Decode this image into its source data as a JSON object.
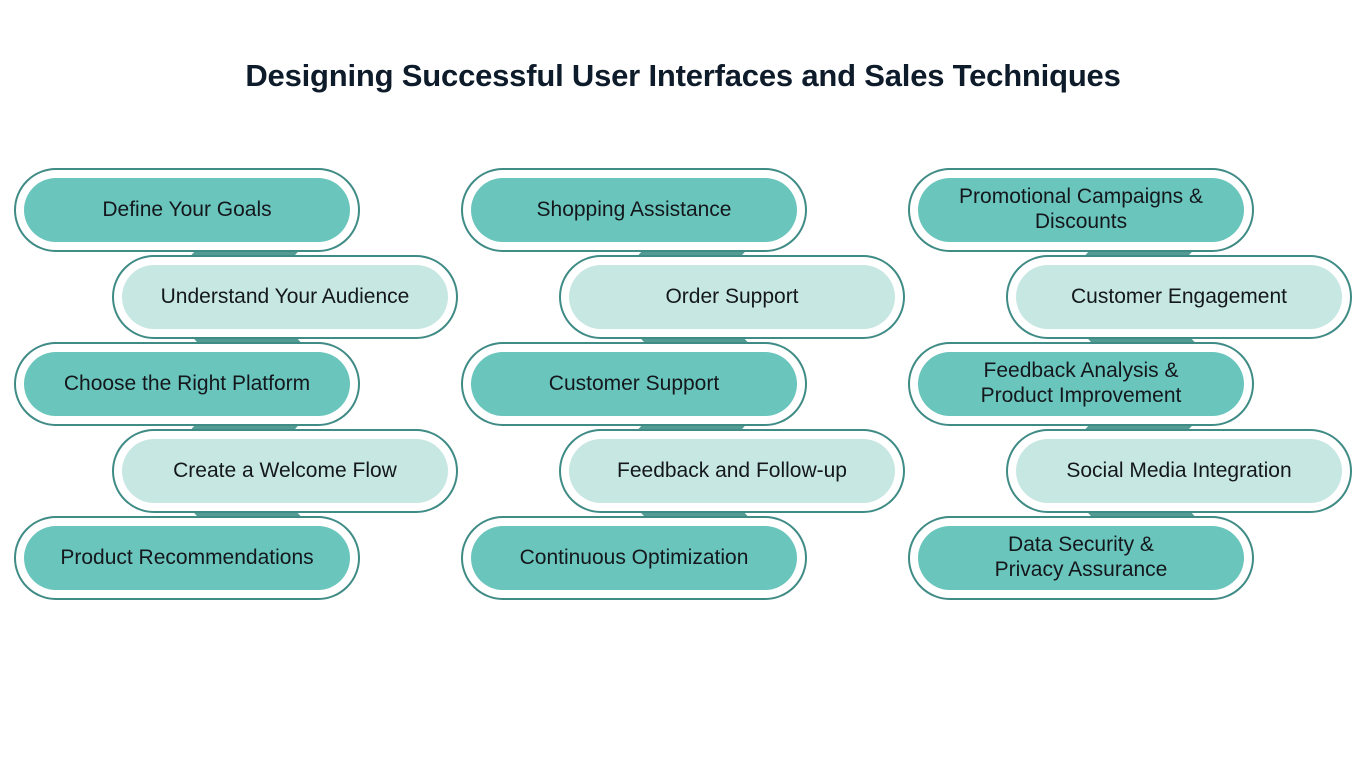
{
  "page": {
    "title": "Designing Successful User Interfaces and Sales Techniques",
    "background_color": "#ffffff"
  },
  "theme": {
    "dark_pill_color": "#6ac5bd",
    "light_pill_color": "#c6e7e2",
    "outline_color": "#3f8b85",
    "connector_color": "#539b93",
    "text_color": "#14181c",
    "title_color": "#0e1b2a"
  },
  "columns": [
    {
      "id": "column-1",
      "steps": [
        {
          "label": "Define Your Goals",
          "tone": "dark",
          "align": "left"
        },
        {
          "label": "Understand Your Audience",
          "tone": "light",
          "align": "right"
        },
        {
          "label": "Choose the Right Platform",
          "tone": "dark",
          "align": "left"
        },
        {
          "label": "Create a Welcome Flow",
          "tone": "light",
          "align": "right"
        },
        {
          "label": "Product Recommendations",
          "tone": "dark",
          "align": "left"
        }
      ]
    },
    {
      "id": "column-2",
      "steps": [
        {
          "label": "Shopping Assistance",
          "tone": "dark",
          "align": "left"
        },
        {
          "label": "Order Support",
          "tone": "light",
          "align": "right"
        },
        {
          "label": "Customer Support",
          "tone": "dark",
          "align": "left"
        },
        {
          "label": "Feedback and Follow-up",
          "tone": "light",
          "align": "right"
        },
        {
          "label": "Continuous Optimization",
          "tone": "dark",
          "align": "left"
        }
      ]
    },
    {
      "id": "column-3",
      "steps": [
        {
          "label": "Promotional Campaigns &\nDiscounts",
          "tone": "dark",
          "align": "left"
        },
        {
          "label": "Customer Engagement",
          "tone": "light",
          "align": "right"
        },
        {
          "label": "Feedback Analysis &\nProduct Improvement",
          "tone": "dark",
          "align": "left"
        },
        {
          "label": "Social Media Integration",
          "tone": "light",
          "align": "right"
        },
        {
          "label": "Data Security &\nPrivacy Assurance",
          "tone": "dark",
          "align": "left"
        }
      ]
    }
  ]
}
